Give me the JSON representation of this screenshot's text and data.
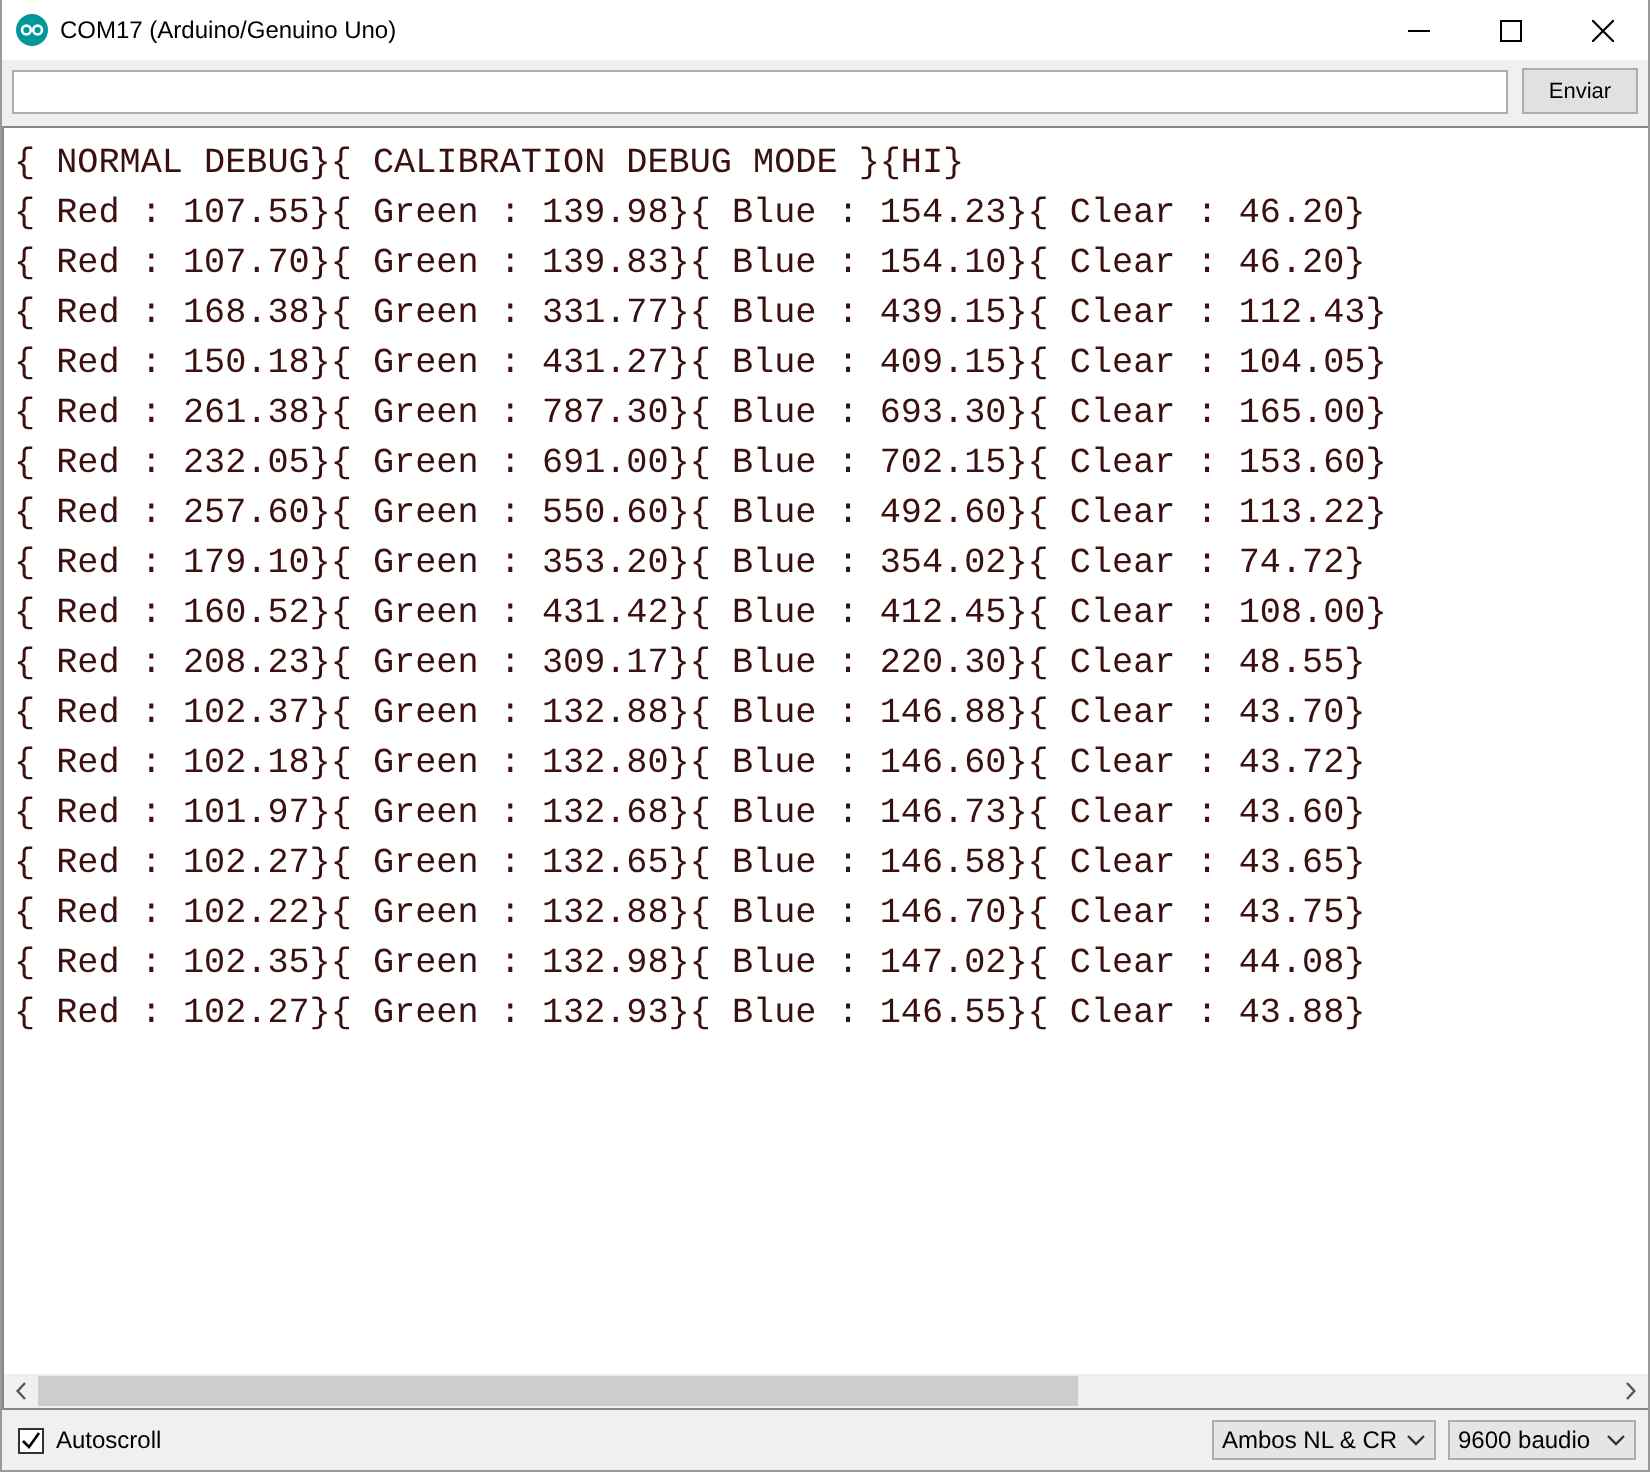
{
  "window": {
    "title": "COM17 (Arduino/Genuino Uno)"
  },
  "send_button": {
    "label": "Enviar"
  },
  "output_lines": [
    "{ NORMAL DEBUG}{ CALIBRATION DEBUG MODE }{HI}",
    "{ Red : 107.55}{ Green : 139.98}{ Blue : 154.23}{ Clear : 46.20}",
    "{ Red : 107.70}{ Green : 139.83}{ Blue : 154.10}{ Clear : 46.20}",
    "{ Red : 168.38}{ Green : 331.77}{ Blue : 439.15}{ Clear : 112.43}",
    "{ Red : 150.18}{ Green : 431.27}{ Blue : 409.15}{ Clear : 104.05}",
    "{ Red : 261.38}{ Green : 787.30}{ Blue : 693.30}{ Clear : 165.00}",
    "{ Red : 232.05}{ Green : 691.00}{ Blue : 702.15}{ Clear : 153.60}",
    "{ Red : 257.60}{ Green : 550.60}{ Blue : 492.60}{ Clear : 113.22}",
    "{ Red : 179.10}{ Green : 353.20}{ Blue : 354.02}{ Clear : 74.72}",
    "{ Red : 160.52}{ Green : 431.42}{ Blue : 412.45}{ Clear : 108.00}",
    "{ Red : 208.23}{ Green : 309.17}{ Blue : 220.30}{ Clear : 48.55}",
    "{ Red : 102.37}{ Green : 132.88}{ Blue : 146.88}{ Clear : 43.70}",
    "{ Red : 102.18}{ Green : 132.80}{ Blue : 146.60}{ Clear : 43.72}",
    "{ Red : 101.97}{ Green : 132.68}{ Blue : 146.73}{ Clear : 43.60}",
    "{ Red : 102.27}{ Green : 132.65}{ Blue : 146.58}{ Clear : 43.65}",
    "{ Red : 102.22}{ Green : 132.88}{ Blue : 146.70}{ Clear : 43.75}",
    "{ Red : 102.35}{ Green : 132.98}{ Blue : 147.02}{ Clear : 44.08}",
    "{ Red : 102.27}{ Green : 132.93}{ Blue : 146.55}{ Clear : 43.88}"
  ],
  "status_bar": {
    "autoscroll": {
      "label": "Autoscroll",
      "checked": true
    },
    "line_ending": {
      "value": "Ambos NL & CR"
    },
    "baud_rate": {
      "value": "9600 baudio"
    }
  }
}
